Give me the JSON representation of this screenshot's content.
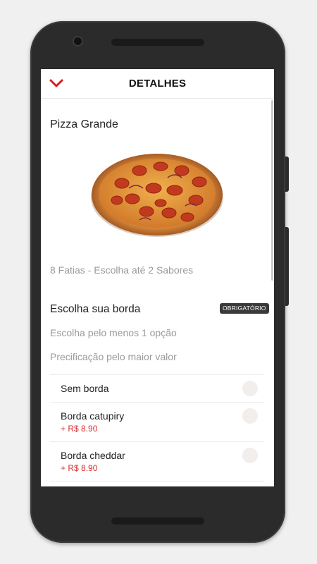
{
  "header": {
    "title": "DETALHES",
    "back_icon": "chevron-down-icon",
    "accent_color": "#d62020"
  },
  "product": {
    "name": "Pizza Grande",
    "image": "pizza-image",
    "description": "8 Fatias - Escolha até 2 Sabores"
  },
  "section": {
    "title": "Escolha sua borda",
    "badge": "OBRIGATÓRIO",
    "note_min": "Escolha pelo menos 1 opção",
    "note_pricing": "Precificação pelo maior valor",
    "options": [
      {
        "name": "Sem borda",
        "price": ""
      },
      {
        "name": "Borda catupiry",
        "price": "+ R$ 8.90"
      },
      {
        "name": "Borda cheddar",
        "price": "+ R$ 8.90"
      }
    ]
  }
}
